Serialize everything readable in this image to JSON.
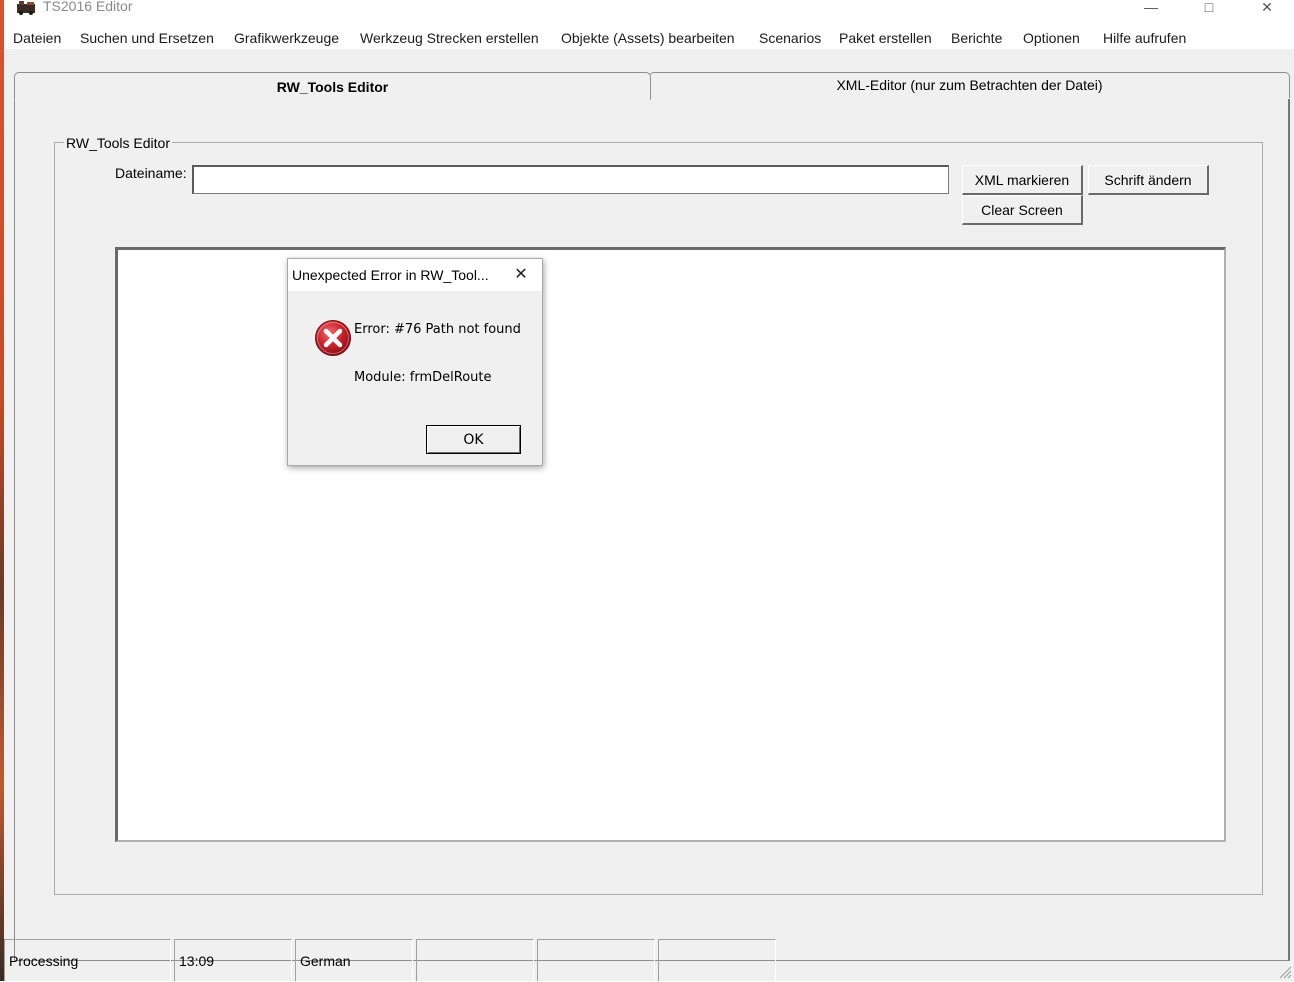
{
  "window": {
    "title": "TS2016 Editor"
  },
  "menu": [
    "Dateien",
    "Suchen und Ersetzen",
    "Grafikwerkzeuge",
    "Werkzeug Strecken erstellen",
    "Objekte (Assets) bearbeiten",
    "Scenarios",
    "Paket erstellen",
    "Berichte",
    "Optionen",
    "Hilfe aufrufen"
  ],
  "tabs": [
    "RW_Tools Editor",
    "XML-Editor (nur zum Betrachten der Datei)"
  ],
  "editor": {
    "group_label": "RW_Tools Editor",
    "filename_label": "Dateiname:",
    "filename_value": "",
    "xml_button": "XML markieren",
    "font_button": "Schrift ändern",
    "clear_button": "Clear Screen"
  },
  "status": [
    "Processing",
    "13:09",
    "German",
    "",
    "",
    ""
  ],
  "dialog": {
    "title": "Unexpected Error in RW_Tool...",
    "close_glyph": "✕",
    "message": "Error: #76 Path not found",
    "module": "Module: frmDelRoute",
    "ok": "OK",
    "icon": "error-icon"
  },
  "icons": {
    "app": "app-icon",
    "window_controls": [
      "minimize-icon",
      "maximize-icon",
      "close-icon"
    ]
  },
  "colors": {
    "window_bg": "#f0f0f0",
    "title_text": "#8a8a8a",
    "error_red": "#c8202a"
  }
}
